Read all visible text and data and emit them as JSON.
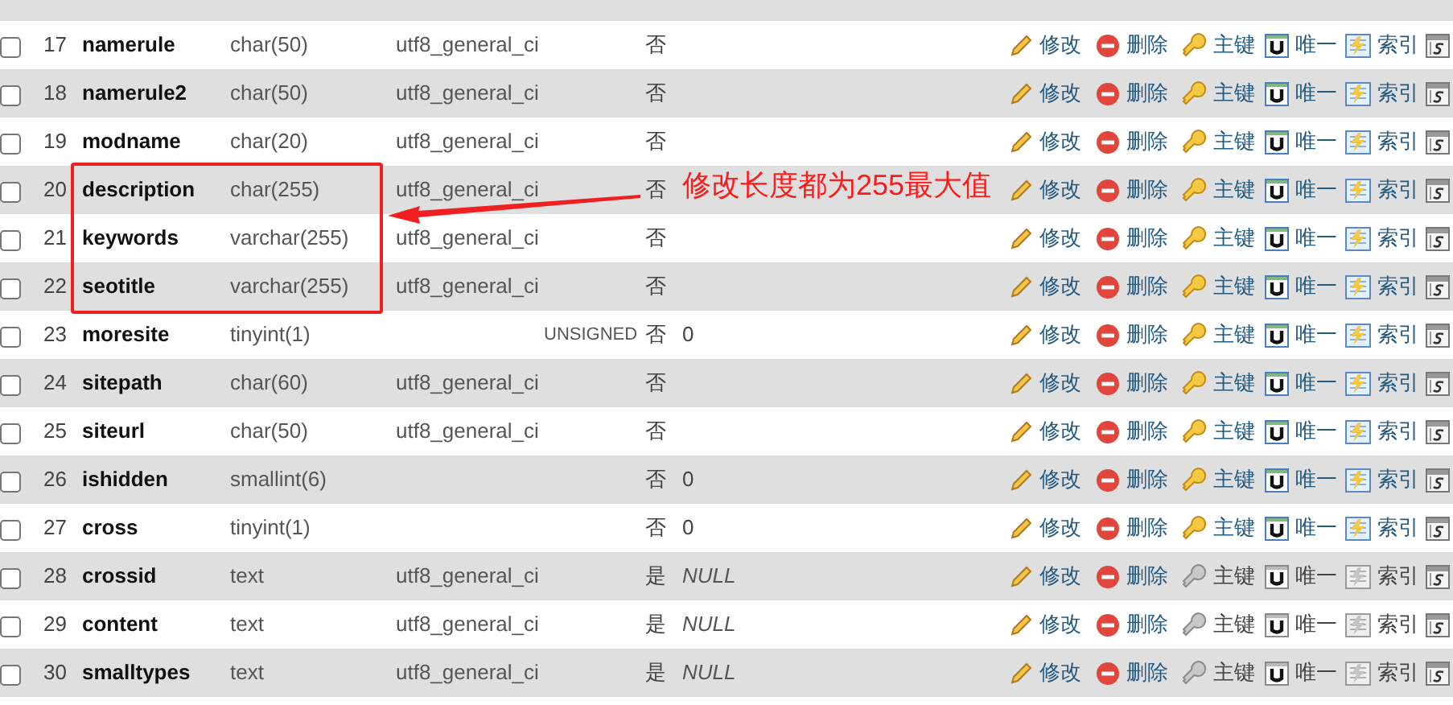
{
  "rows": [
    {
      "number": "17",
      "name": "namerule",
      "type": "char(50)",
      "collation": "utf8_general_ci",
      "null": "否",
      "checked": false,
      "actions": [
        {
          "kind": "edit",
          "label": "修改"
        },
        {
          "kind": "delete",
          "label": "删除"
        },
        {
          "kind": "primary",
          "label": "主键",
          "disabled": false
        },
        {
          "kind": "unique",
          "label": "唯一",
          "disabled": false
        },
        {
          "kind": "index",
          "label": "索引",
          "disabled": false
        },
        {
          "kind": "spatial"
        }
      ]
    },
    {
      "number": "18",
      "name": "namerule2",
      "type": "char(50)",
      "collation": "utf8_general_ci",
      "null": "否",
      "checked": false,
      "actions": [
        {
          "kind": "edit",
          "label": "修改"
        },
        {
          "kind": "delete",
          "label": "删除"
        },
        {
          "kind": "primary",
          "label": "主键",
          "disabled": false
        },
        {
          "kind": "unique",
          "label": "唯一",
          "disabled": false
        },
        {
          "kind": "index",
          "label": "索引",
          "disabled": false
        },
        {
          "kind": "spatial"
        }
      ]
    },
    {
      "number": "19",
      "name": "modname",
      "type": "char(20)",
      "collation": "utf8_general_ci",
      "null": "否",
      "checked": false,
      "actions": [
        {
          "kind": "edit",
          "label": "修改"
        },
        {
          "kind": "delete",
          "label": "删除"
        },
        {
          "kind": "primary",
          "label": "主键",
          "disabled": false
        },
        {
          "kind": "unique",
          "label": "唯一",
          "disabled": false
        },
        {
          "kind": "index",
          "label": "索引",
          "disabled": false
        },
        {
          "kind": "spatial"
        }
      ]
    },
    {
      "number": "20",
      "name": "description",
      "type": "char(255)",
      "collation": "utf8_general_ci",
      "null": "否",
      "checked": false,
      "actions": [
        {
          "kind": "edit",
          "label": "修改"
        },
        {
          "kind": "delete",
          "label": "删除"
        },
        {
          "kind": "primary",
          "label": "主键",
          "disabled": false
        },
        {
          "kind": "unique",
          "label": "唯一",
          "disabled": false
        },
        {
          "kind": "index",
          "label": "索引",
          "disabled": false
        },
        {
          "kind": "spatial"
        }
      ]
    },
    {
      "number": "21",
      "name": "keywords",
      "type": "varchar(255)",
      "collation": "utf8_general_ci",
      "null": "否",
      "checked": false,
      "actions": [
        {
          "kind": "edit",
          "label": "修改"
        },
        {
          "kind": "delete",
          "label": "删除"
        },
        {
          "kind": "primary",
          "label": "主键",
          "disabled": false
        },
        {
          "kind": "unique",
          "label": "唯一",
          "disabled": false
        },
        {
          "kind": "index",
          "label": "索引",
          "disabled": false
        },
        {
          "kind": "spatial"
        }
      ]
    },
    {
      "number": "22",
      "name": "seotitle",
      "type": "varchar(255)",
      "collation": "utf8_general_ci",
      "null": "否",
      "checked": false,
      "actions": [
        {
          "kind": "edit",
          "label": "修改"
        },
        {
          "kind": "delete",
          "label": "删除"
        },
        {
          "kind": "primary",
          "label": "主键",
          "disabled": false
        },
        {
          "kind": "unique",
          "label": "唯一",
          "disabled": false
        },
        {
          "kind": "index",
          "label": "索引",
          "disabled": false
        },
        {
          "kind": "spatial"
        }
      ]
    },
    {
      "number": "23",
      "name": "moresite",
      "type": "tinyint(1)",
      "attributes": "UNSIGNED",
      "null": "否",
      "default": "0",
      "checked": false,
      "actions": [
        {
          "kind": "edit",
          "label": "修改"
        },
        {
          "kind": "delete",
          "label": "删除"
        },
        {
          "kind": "primary",
          "label": "主键",
          "disabled": false
        },
        {
          "kind": "unique",
          "label": "唯一",
          "disabled": false
        },
        {
          "kind": "index",
          "label": "索引",
          "disabled": false
        },
        {
          "kind": "spatial"
        }
      ]
    },
    {
      "number": "24",
      "name": "sitepath",
      "type": "char(60)",
      "collation": "utf8_general_ci",
      "null": "否",
      "checked": false,
      "actions": [
        {
          "kind": "edit",
          "label": "修改"
        },
        {
          "kind": "delete",
          "label": "删除"
        },
        {
          "kind": "primary",
          "label": "主键",
          "disabled": false
        },
        {
          "kind": "unique",
          "label": "唯一",
          "disabled": false
        },
        {
          "kind": "index",
          "label": "索引",
          "disabled": false
        },
        {
          "kind": "spatial"
        }
      ]
    },
    {
      "number": "25",
      "name": "siteurl",
      "type": "char(50)",
      "collation": "utf8_general_ci",
      "null": "否",
      "checked": false,
      "actions": [
        {
          "kind": "edit",
          "label": "修改"
        },
        {
          "kind": "delete",
          "label": "删除"
        },
        {
          "kind": "primary",
          "label": "主键",
          "disabled": false
        },
        {
          "kind": "unique",
          "label": "唯一",
          "disabled": false
        },
        {
          "kind": "index",
          "label": "索引",
          "disabled": false
        },
        {
          "kind": "spatial"
        }
      ]
    },
    {
      "number": "26",
      "name": "ishidden",
      "type": "smallint(6)",
      "null": "否",
      "default": "0",
      "checked": false,
      "actions": [
        {
          "kind": "edit",
          "label": "修改"
        },
        {
          "kind": "delete",
          "label": "删除"
        },
        {
          "kind": "primary",
          "label": "主键",
          "disabled": false
        },
        {
          "kind": "unique",
          "label": "唯一",
          "disabled": false
        },
        {
          "kind": "index",
          "label": "索引",
          "disabled": false
        },
        {
          "kind": "spatial"
        }
      ]
    },
    {
      "number": "27",
      "name": "cross",
      "type": "tinyint(1)",
      "null": "否",
      "default": "0",
      "checked": false,
      "actions": [
        {
          "kind": "edit",
          "label": "修改"
        },
        {
          "kind": "delete",
          "label": "删除"
        },
        {
          "kind": "primary",
          "label": "主键",
          "disabled": false
        },
        {
          "kind": "unique",
          "label": "唯一",
          "disabled": false
        },
        {
          "kind": "index",
          "label": "索引",
          "disabled": false
        },
        {
          "kind": "spatial"
        }
      ]
    },
    {
      "number": "28",
      "name": "crossid",
      "type": "text",
      "collation": "utf8_general_ci",
      "null": "是",
      "default": "NULL",
      "italic": true,
      "checked": false,
      "actions": [
        {
          "kind": "edit",
          "label": "修改"
        },
        {
          "kind": "delete",
          "label": "删除"
        },
        {
          "kind": "primary",
          "label": "主键",
          "disabled": true
        },
        {
          "kind": "unique",
          "label": "唯一",
          "disabled": true
        },
        {
          "kind": "index",
          "label": "索引",
          "disabled": true
        },
        {
          "kind": "spatial"
        }
      ]
    },
    {
      "number": "29",
      "name": "content",
      "type": "text",
      "collation": "utf8_general_ci",
      "null": "是",
      "default": "NULL",
      "italic": true,
      "checked": false,
      "actions": [
        {
          "kind": "edit",
          "label": "修改"
        },
        {
          "kind": "delete",
          "label": "删除"
        },
        {
          "kind": "primary",
          "label": "主键",
          "disabled": true
        },
        {
          "kind": "unique",
          "label": "唯一",
          "disabled": true
        },
        {
          "kind": "index",
          "label": "索引",
          "disabled": true
        },
        {
          "kind": "spatial"
        }
      ]
    },
    {
      "number": "30",
      "name": "smalltypes",
      "type": "text",
      "collation": "utf8_general_ci",
      "null": "是",
      "default": "NULL",
      "italic": true,
      "checked": false,
      "actions": [
        {
          "kind": "edit",
          "label": "修改"
        },
        {
          "kind": "delete",
          "label": "删除"
        },
        {
          "kind": "primary",
          "label": "主键",
          "disabled": true
        },
        {
          "kind": "unique",
          "label": "唯一",
          "disabled": true
        },
        {
          "kind": "index",
          "label": "索引",
          "disabled": true
        },
        {
          "kind": "spatial"
        }
      ]
    }
  ],
  "annotation": {
    "text": "修改长度都为255最大值"
  }
}
